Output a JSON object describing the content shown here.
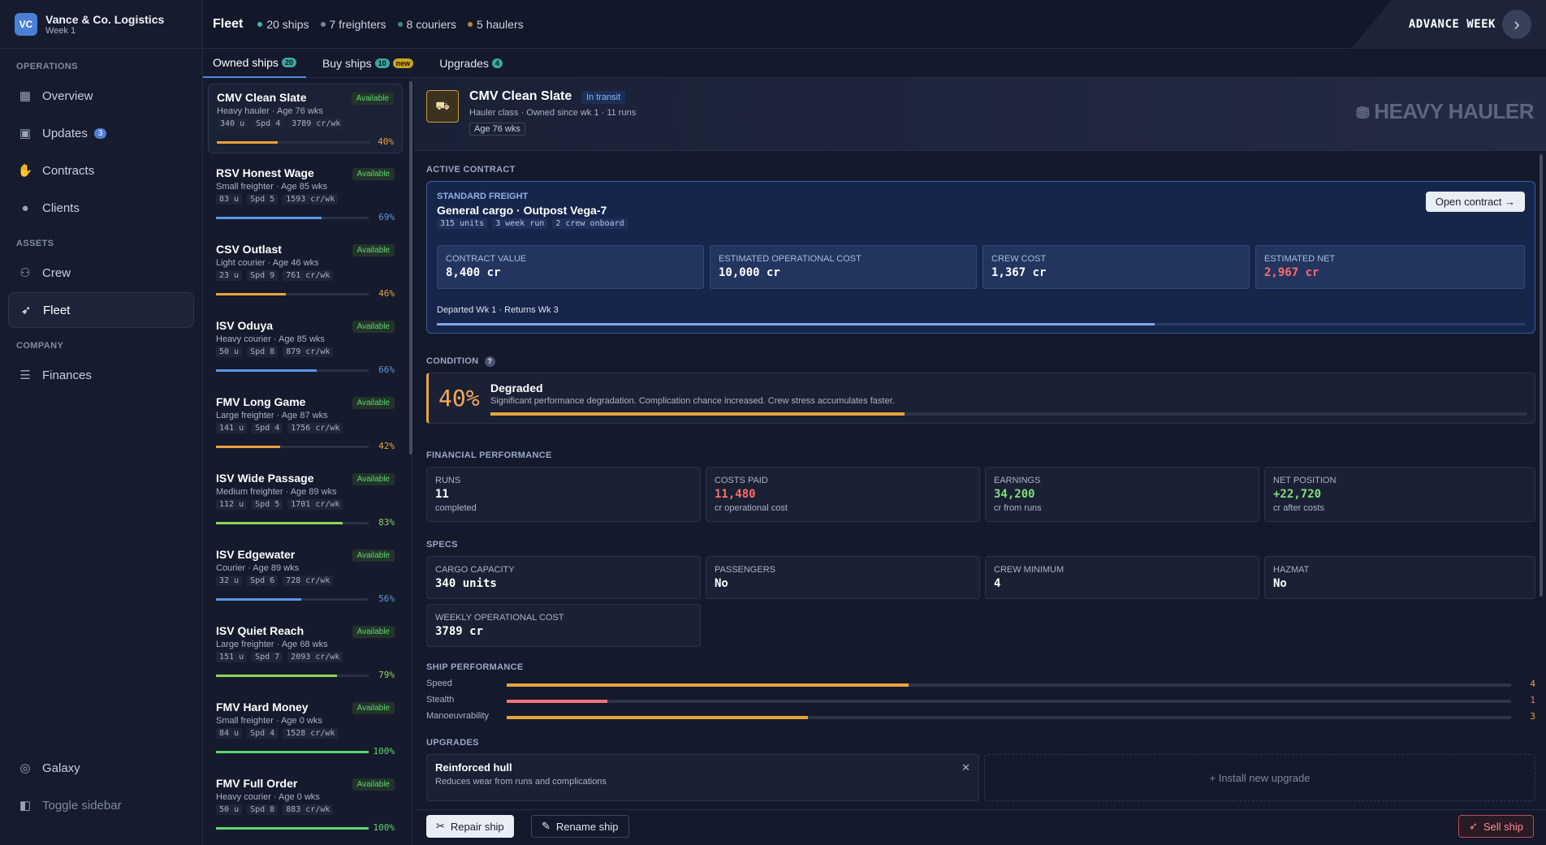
{
  "app": {
    "logo": "VC",
    "company": "Vance & Co. Logistics",
    "week": "Week 1"
  },
  "sidebar": {
    "sections": [
      {
        "label": "OPERATIONS"
      },
      {
        "label": "ASSETS"
      },
      {
        "label": "COMPANY"
      }
    ],
    "items": [
      {
        "label": "Overview",
        "icon": "grid-icon"
      },
      {
        "label": "Updates",
        "icon": "calendar-icon",
        "count": "3"
      },
      {
        "label": "Contracts",
        "icon": "handshake-icon"
      },
      {
        "label": "Clients",
        "icon": "person-icon"
      },
      {
        "label": "Crew",
        "icon": "people-icon"
      },
      {
        "label": "Fleet",
        "icon": "rocket-icon",
        "active": true
      },
      {
        "label": "Finances",
        "icon": "coins-icon"
      }
    ],
    "bottom": [
      {
        "label": "Galaxy",
        "icon": "galaxy-icon"
      },
      {
        "label": "Toggle sidebar",
        "icon": "sidebar-toggle-icon"
      }
    ]
  },
  "topbar": {
    "title": "Fleet",
    "stats": [
      {
        "label": "20 ships",
        "color": "#3fb7ae"
      },
      {
        "label": "7 freighters",
        "color": "#7d869c"
      },
      {
        "label": "8 couriers",
        "color": "#3b8c78"
      },
      {
        "label": "5 haulers",
        "color": "#b9843a"
      }
    ],
    "advance_label": "ADVANCE WEEK"
  },
  "tabs": [
    {
      "label": "Owned ships",
      "badge": "20"
    },
    {
      "label": "Buy ships",
      "badge": "10",
      "extra": "new"
    },
    {
      "label": "Upgrades",
      "badge": "4"
    }
  ],
  "ships": [
    {
      "name": "CMV Clean Slate",
      "status": "Available",
      "desc": "Heavy hauler · Age 76 wks",
      "cargo": "340 u",
      "speed": "Spd 4",
      "cost": "3789 cr/wk",
      "condition": 40,
      "condition_label": "40%"
    },
    {
      "name": "RSV Honest Wage",
      "status": "Available",
      "desc": "Small freighter · Age 85 wks",
      "cargo": "83 u",
      "speed": "Spd 5",
      "cost": "1593 cr/wk",
      "condition": 69,
      "condition_label": "69%"
    },
    {
      "name": "CSV Outlast",
      "status": "Available",
      "desc": "Light courier · Age 46 wks",
      "cargo": "23 u",
      "speed": "Spd 9",
      "cost": "761 cr/wk",
      "condition": 46,
      "condition_label": "46%"
    },
    {
      "name": "ISV Oduya",
      "status": "Available",
      "desc": "Heavy courier · Age 85 wks",
      "cargo": "50 u",
      "speed": "Spd 8",
      "cost": "879 cr/wk",
      "condition": 66,
      "condition_label": "66%"
    },
    {
      "name": "FMV Long Game",
      "status": "Available",
      "desc": "Large freighter · Age 87 wks",
      "cargo": "141 u",
      "speed": "Spd 4",
      "cost": "1756 cr/wk",
      "condition": 42,
      "condition_label": "42%"
    },
    {
      "name": "ISV Wide Passage",
      "status": "Available",
      "desc": "Medium freighter · Age 89 wks",
      "cargo": "112 u",
      "speed": "Spd 5",
      "cost": "1701 cr/wk",
      "condition": 83,
      "condition_label": "83%"
    },
    {
      "name": "ISV Edgewater",
      "status": "Available",
      "desc": "Courier · Age 89 wks",
      "cargo": "32 u",
      "speed": "Spd 6",
      "cost": "728 cr/wk",
      "condition": 56,
      "condition_label": "56%"
    },
    {
      "name": "ISV Quiet Reach",
      "status": "Available",
      "desc": "Large freighter · Age 68 wks",
      "cargo": "151 u",
      "speed": "Spd 7",
      "cost": "2093 cr/wk",
      "condition": 79,
      "condition_label": "79%"
    },
    {
      "name": "FMV Hard Money",
      "status": "Available",
      "desc": "Small freighter · Age 0 wks",
      "cargo": "84 u",
      "speed": "Spd 4",
      "cost": "1528 cr/wk",
      "condition": 100,
      "condition_label": "100%"
    },
    {
      "name": "FMV Full Order",
      "status": "Available",
      "desc": "Heavy courier · Age 0 wks",
      "cargo": "50 u",
      "speed": "Spd 8",
      "cost": "883 cr/wk",
      "condition": 100,
      "condition_label": "100%"
    }
  ],
  "detail": {
    "name": "CMV Clean Slate",
    "status": "In transit",
    "sub": "Hauler class · Owned since wk 1 · 11 runs",
    "age": "Age 76 wks",
    "type": "HEAVY HAULER",
    "contract": {
      "heading": "ACTIVE CONTRACT",
      "type": "STANDARD FREIGHT",
      "name": "General cargo · Outpost Vega-7",
      "chips": [
        "315 units",
        "3 week run",
        "2 crew onboard"
      ],
      "open_label": "Open contract",
      "boxes": [
        {
          "label": "CONTRACT VALUE",
          "value": "8,400 cr",
          "color": "#ffffff"
        },
        {
          "label": "ESTIMATED OPERATIONAL COST",
          "value": "10,000 cr",
          "color": "#ffffff"
        },
        {
          "label": "CREW COST",
          "value": "1,367 cr",
          "color": "#ffffff"
        },
        {
          "label": "ESTIMATED NET",
          "value": "2,967 cr",
          "color": "#ff6b6b"
        }
      ],
      "departure": "Departed Wk 1 · Returns Wk 3",
      "progress": 0.66
    },
    "condition": {
      "heading": "CONDITION",
      "pct": "40%",
      "value": 40,
      "label": "Degraded",
      "desc": "Significant performance degradation. Complication chance increased. Crew stress accumulates faster."
    },
    "financial": {
      "heading": "FINANCIAL PERFORMANCE",
      "boxes": [
        {
          "label": "RUNS",
          "value": "11",
          "sub": "completed",
          "color": "#ffffff"
        },
        {
          "label": "COSTS PAID",
          "value": "11,480",
          "sub": "cr operational cost",
          "color": "#ff6b6b"
        },
        {
          "label": "EARNINGS",
          "value": "34,200",
          "sub": "cr from runs",
          "color": "#7ee07a"
        },
        {
          "label": "NET POSITION",
          "value": "+22,720",
          "sub": "cr after costs",
          "color": "#7ee07a"
        }
      ]
    },
    "specs": {
      "heading": "SPECS",
      "boxes": [
        {
          "label": "CARGO CAPACITY",
          "value": "340 units"
        },
        {
          "label": "PASSENGERS",
          "value": "No"
        },
        {
          "label": "CREW MINIMUM",
          "value": "4"
        },
        {
          "label": "HAZMAT",
          "value": "No"
        },
        {
          "label": "WEEKLY OPERATIONAL COST",
          "value": "3789 cr"
        }
      ]
    },
    "performance": {
      "heading": "SHIP PERFORMANCE",
      "stats": [
        {
          "label": "Speed",
          "value": "4",
          "level": 0.4,
          "color": "#e9a33d"
        },
        {
          "label": "Stealth",
          "value": "1",
          "level": 0.1,
          "color": "#f2727a"
        },
        {
          "label": "Manoeuvrability",
          "value": "3",
          "level": 0.3,
          "color": "#e9a33d"
        }
      ]
    },
    "upgrades": {
      "heading": "UPGRADES",
      "items": [
        {
          "name": "Reinforced hull",
          "desc": "Reduces wear from runs and complications"
        }
      ],
      "install_label": "+ Install new upgrade"
    }
  },
  "footer": {
    "repair": "Repair ship",
    "rename": "Rename ship",
    "sell": "Sell ship"
  }
}
